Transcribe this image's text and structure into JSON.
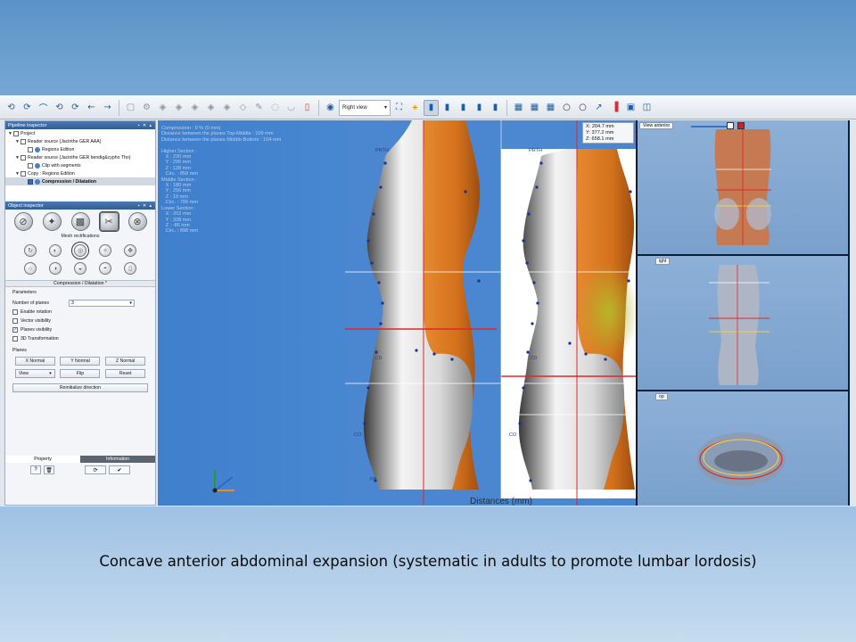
{
  "toolbar": {
    "view_select": "Right view",
    "icons_left": [
      "load-icon",
      "load-icon",
      "curve-icon",
      "load-icon",
      "load-icon",
      "undo-icon",
      "redo-icon"
    ],
    "icons_gray": [
      "copy-icon",
      "settings-icon",
      "cube-icon",
      "cube-icon",
      "cube-icon",
      "cube-icon",
      "cube-icon",
      "cube-icon"
    ]
  },
  "pipeline": {
    "title": "Pipeline inspector",
    "items": [
      {
        "label": "Project",
        "indent": 0,
        "checked": false,
        "expand": "▼"
      },
      {
        "label": "Reader source (Jacinthe GER AAA)",
        "indent": 1,
        "checked": false,
        "expand": "▼"
      },
      {
        "label": "Regions Edition",
        "indent": 2,
        "checked": false,
        "expand": ""
      },
      {
        "label": "Reader source (Jacinthe GER bendig&cypho Tho)",
        "indent": 1,
        "checked": false,
        "expand": "▼"
      },
      {
        "label": "Clip with segments",
        "indent": 2,
        "checked": false,
        "expand": ""
      },
      {
        "label": "Copy : Regions Edition",
        "indent": 1,
        "checked": false,
        "expand": "▼"
      },
      {
        "label": "Compression / Dilatation",
        "indent": 2,
        "checked": true,
        "expand": "",
        "selected": true
      }
    ]
  },
  "object_inspector": {
    "title": "Object inspector",
    "mesh_label": "Mesh rectifications",
    "section_title": "Compression / Dilatation *",
    "parameters_label": "Parameters",
    "number_of_planes_label": "Number of planes",
    "number_of_planes_value": "3",
    "checkboxes": [
      {
        "label": "Enable rotation",
        "checked": false
      },
      {
        "label": "Vector visibility",
        "checked": false
      },
      {
        "label": "Planes visibility",
        "checked": true
      },
      {
        "label": "3D Transformation",
        "checked": false
      }
    ],
    "planes_label": "Planes",
    "normal_buttons": [
      "X Normal",
      "Y Normal",
      "Z Normal"
    ],
    "view_select": "View",
    "flip_label": "Flip",
    "reset_label": "Reset",
    "reinit_label": "Reinitialize direction",
    "tab_property": "Property",
    "tab_information": "Information"
  },
  "viewport": {
    "info_lines": "Compression : 0 % (0 mm)\nDistance between the planes Top-Middle : 109 mm\nDistance between the planes Middle-Bottom : 104 mm\n\nHigher Section :\n   X : 230 mm\n   Y : 295 mm\n   Z : 128 mm\n   Circ. : 858 mm\nMiddle Section :\n   X : 180 mm\n   Y : 256 mm\n   Z : 19 mm\n   Circ. : 706 mm\nLower Section :\n   X : 202 mm\n   Y : 338 mm\n   Z : -86 mm\n   Circ. : 898 mm",
    "coords": "X: 204.7 mm\nY: 377.2 mm\nZ: 658.1 mm",
    "axis_caption": "Distances (mm)",
    "point_labels": [
      "PRTH",
      "PRTH",
      "C0",
      "C0",
      "CO",
      "CO",
      "PB"
    ]
  },
  "right_views": {
    "top_label": "View anterior",
    "middle_label": "ight",
    "bottom_label": "op"
  },
  "caption": "Concave anterior abdominal expansion (systematic in adults to promote lumbar lordosis)",
  "colors": {
    "viewport_bg": "#4682ce",
    "torso_orange": "#d9761e",
    "torso_white": "#e8e8e8",
    "plane_red": "#e0262a",
    "highlight_yellow": "#b8b52a"
  }
}
